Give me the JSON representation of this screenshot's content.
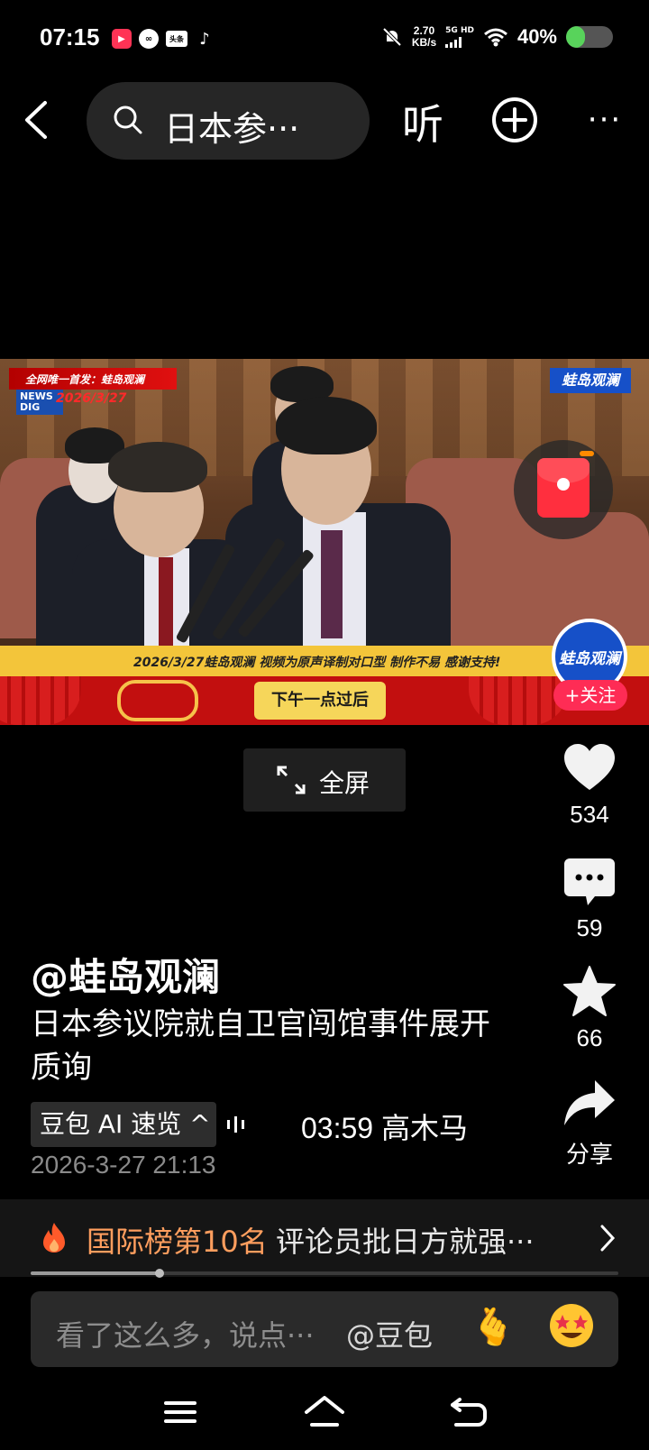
{
  "status_bar": {
    "time": "07:15",
    "net_speed_value": "2.70",
    "net_speed_unit": "KB/s",
    "network_type": "5G HD",
    "battery_percent": "40%",
    "battery_level": 0.4,
    "notification_icons": [
      "app-red-icon",
      "app-white-icon",
      "toutiao-icon",
      "tiktok-icon"
    ],
    "toutiao_label": "头条"
  },
  "top_nav": {
    "search_text": "日本参···",
    "listen_label": "听"
  },
  "video": {
    "badge_text": "全网唯一首发：蛙岛观澜",
    "badge_date": "2026/3/27",
    "news_tag": "NEWS DIG",
    "logo_text": "蛙岛观澜",
    "subtitle_text": "2026/3/27蛙岛观澜 视频为原声译制对口型 制作不易 感谢支持!",
    "caption_text": "下午一点过后"
  },
  "creator": {
    "avatar_text": "蛙岛观澜",
    "follow_label": "+关注"
  },
  "fullscreen_label": "全屏",
  "rail": {
    "likes": "534",
    "comments": "59",
    "favorites": "66",
    "share_label": "分享"
  },
  "post": {
    "author": "@蛙岛观澜",
    "title": "日本参议院就自卫官闯馆事件展开质询",
    "ai_summary_label": "豆包 AI 速览 ^",
    "timeline_text": "03:59 高木马",
    "post_time": "2026-3-27 21:13"
  },
  "rank": {
    "label": "国际榜第10名",
    "separator": "·",
    "description": "评论员批日方就强···"
  },
  "playback_progress": 0.22,
  "comment_bar": {
    "placeholder": "看了这么多，说点···",
    "mention": "@豆包",
    "emoji_1": "🫰"
  },
  "colors": {
    "accent_pink": "#fe2c55",
    "rank_orange": "#ff9e5e",
    "battery_green": "#58d35b"
  }
}
